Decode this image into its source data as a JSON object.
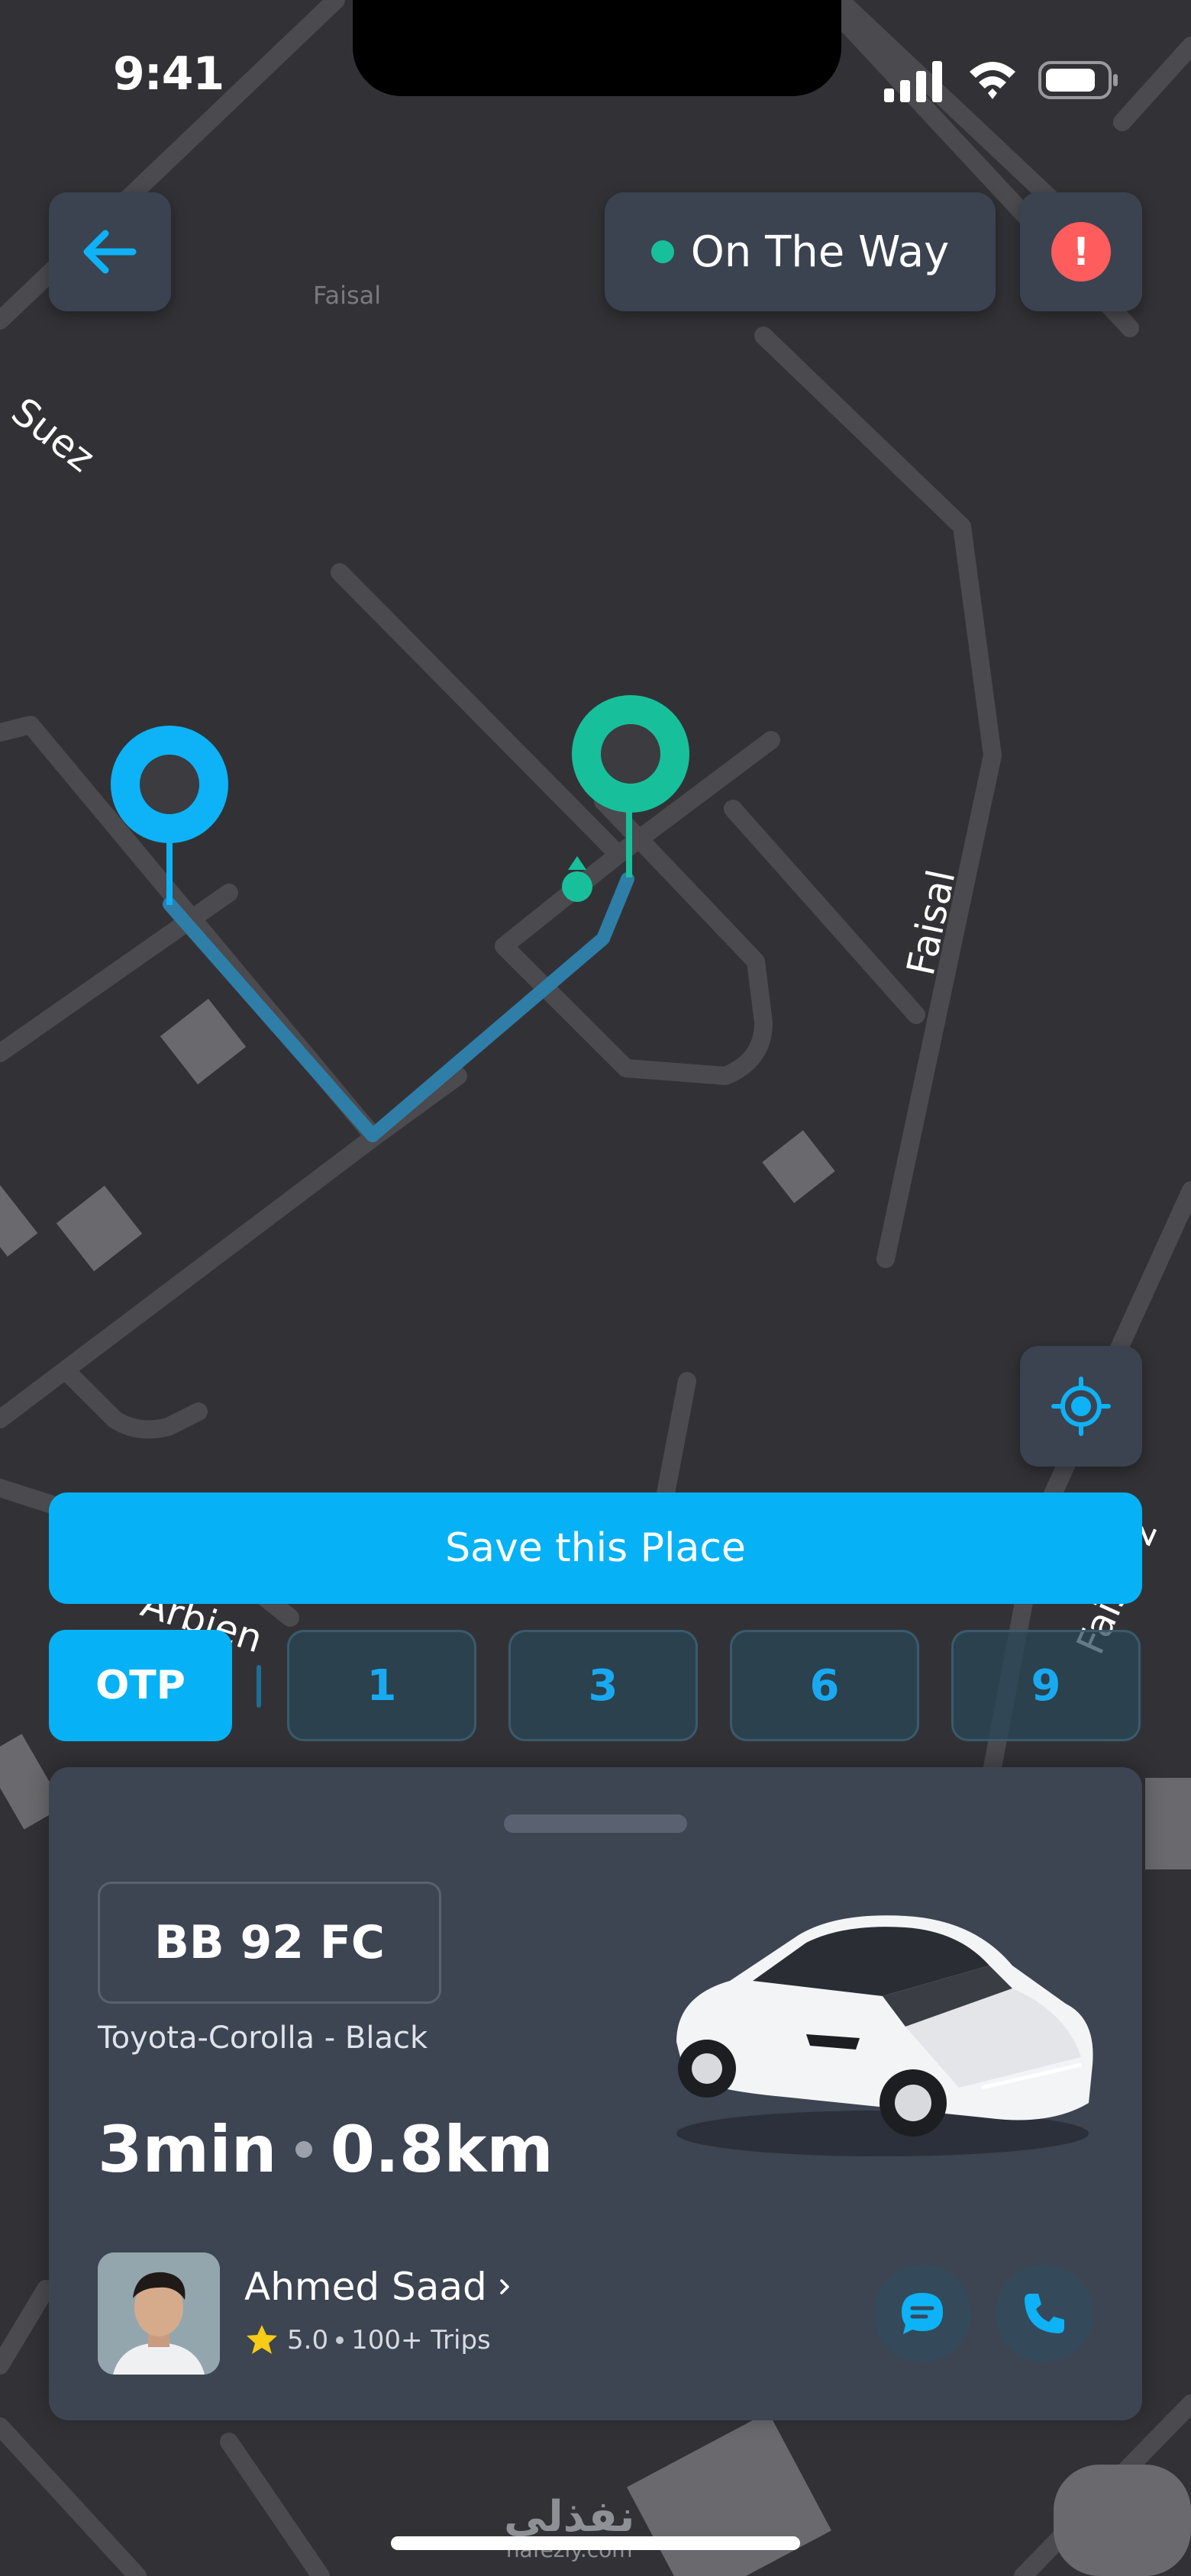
{
  "status_bar": {
    "time": "9:41"
  },
  "header": {
    "trip_status": "On The Way",
    "status_color": "#17c09a",
    "alert_color": "#ff5d5d"
  },
  "icons": {
    "back": "arrow-left-icon",
    "alert": "exclamation-icon",
    "locate": "crosshair-icon",
    "chat": "chat-icon",
    "call": "phone-icon",
    "rating": "star-icon"
  },
  "map": {
    "labels": {
      "suez": "Suez",
      "faisal_top": "Faisal",
      "faisal_right": "Faisal",
      "arbien": "Arbien",
      "faisal_bottom": "Faisal 2"
    },
    "pickup_color": "#0eb2f7",
    "destination_color": "#17c09a"
  },
  "actions": {
    "save_place": "Save this Place"
  },
  "otp": {
    "label": "OTP",
    "digits": [
      "1",
      "3",
      "6",
      "9"
    ]
  },
  "trip": {
    "plate": "BB 92 FC",
    "car_model": "Toyota-Corolla - Black",
    "eta_time": "3min",
    "eta_distance": "0.8km"
  },
  "driver": {
    "name": "Ahmed Saad",
    "rating": "5.0",
    "trips": "100+ Trips"
  },
  "watermark": {
    "brand": "نفذلي",
    "url": "nafezly.com"
  },
  "accent": "#06b2f5"
}
